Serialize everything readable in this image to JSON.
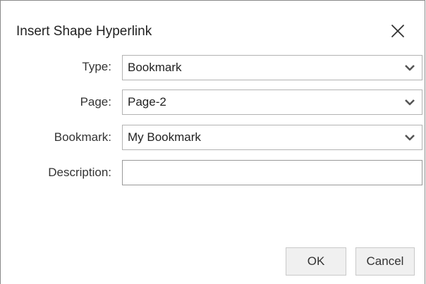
{
  "dialog": {
    "title": "Insert Shape Hyperlink"
  },
  "fields": {
    "type": {
      "label": "Type:",
      "value": "Bookmark"
    },
    "page": {
      "label": "Page:",
      "value": "Page-2"
    },
    "bookmark": {
      "label": "Bookmark:",
      "value": "My Bookmark"
    },
    "description": {
      "label": "Description:",
      "value": ""
    }
  },
  "buttons": {
    "ok_label": "OK",
    "cancel_label": "Cancel"
  },
  "icons": {
    "close": "close-icon",
    "dropdown": "chevron-down-icon"
  }
}
